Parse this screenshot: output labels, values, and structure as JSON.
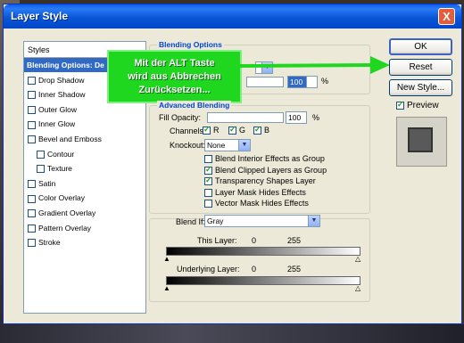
{
  "window": {
    "title": "Layer Style",
    "close_label": "X"
  },
  "styles_panel": {
    "header": "Styles",
    "items": [
      {
        "label": "Blending Options: De",
        "checkbox": false,
        "checked": false,
        "indent": 0,
        "selected": true
      },
      {
        "label": "Drop Shadow",
        "checkbox": true,
        "checked": false,
        "indent": 0
      },
      {
        "label": "Inner Shadow",
        "checkbox": true,
        "checked": false,
        "indent": 0
      },
      {
        "label": "Outer Glow",
        "checkbox": true,
        "checked": false,
        "indent": 0
      },
      {
        "label": "Inner Glow",
        "checkbox": true,
        "checked": false,
        "indent": 0
      },
      {
        "label": "Bevel and Emboss",
        "checkbox": true,
        "checked": false,
        "indent": 0
      },
      {
        "label": "Contour",
        "checkbox": true,
        "checked": false,
        "indent": 1
      },
      {
        "label": "Texture",
        "checkbox": true,
        "checked": false,
        "indent": 1
      },
      {
        "label": "Satin",
        "checkbox": true,
        "checked": false,
        "indent": 0
      },
      {
        "label": "Color Overlay",
        "checkbox": true,
        "checked": false,
        "indent": 0
      },
      {
        "label": "Gradient Overlay",
        "checkbox": true,
        "checked": false,
        "indent": 0
      },
      {
        "label": "Pattern Overlay",
        "checkbox": true,
        "checked": false,
        "indent": 0
      },
      {
        "label": "Stroke",
        "checkbox": true,
        "checked": false,
        "indent": 0
      }
    ]
  },
  "blending": {
    "group_title": "Blending Options",
    "opacity_value": "100",
    "percent": "%"
  },
  "advanced": {
    "group_title": "Advanced Blending",
    "fill_opacity_label": "Fill Opacity:",
    "fill_opacity_value": "100",
    "percent": "%",
    "channels_label": "Channels:",
    "channel_r": "R",
    "channel_g": "G",
    "channel_b": "B",
    "knockout_label": "Knockout:",
    "knockout_value": "None",
    "options": [
      {
        "label": "Blend Interior Effects as Group",
        "checked": false
      },
      {
        "label": "Blend Clipped Layers as Group",
        "checked": true
      },
      {
        "label": "Transparency Shapes Layer",
        "checked": true
      },
      {
        "label": "Layer Mask Hides Effects",
        "checked": false
      },
      {
        "label": "Vector Mask Hides Effects",
        "checked": false
      }
    ]
  },
  "blend_if": {
    "label": "Blend If:",
    "value": "Gray",
    "this_layer_label": "This Layer:",
    "this_layer_min": "0",
    "this_layer_max": "255",
    "underlying_label": "Underlying Layer:",
    "underlying_min": "0",
    "underlying_max": "255"
  },
  "buttons": {
    "ok": "OK",
    "reset": "Reset",
    "new_style": "New Style...",
    "preview": "Preview",
    "preview_checked": true
  },
  "annotation": {
    "line1": "Mit der ALT Taste",
    "line2": "wird aus Abbrechen",
    "line3": "Zurücksetzen...",
    "color": "#1ed71e"
  }
}
